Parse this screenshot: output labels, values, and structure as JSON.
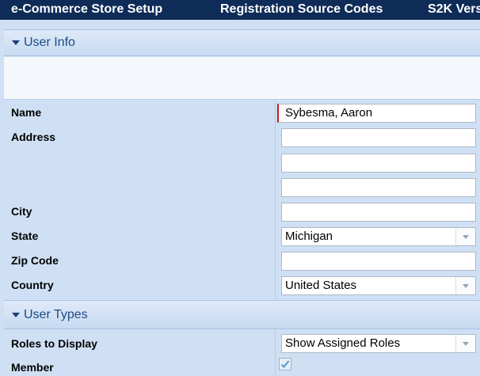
{
  "nav": {
    "items": [
      "e-Commerce Store Setup",
      "Registration Source Codes",
      "S2K Vers"
    ]
  },
  "user_info": {
    "section_title": "User Info",
    "fields": {
      "name": {
        "label": "Name",
        "value": "Sybesma, Aaron"
      },
      "address": {
        "label": "Address",
        "values": [
          "",
          "",
          ""
        ]
      },
      "city": {
        "label": "City",
        "value": ""
      },
      "state": {
        "label": "State",
        "value": "Michigan"
      },
      "zip": {
        "label": "Zip Code",
        "value": ""
      },
      "country": {
        "label": "Country",
        "value": "United States"
      }
    }
  },
  "user_types": {
    "section_title": "User Types",
    "roles": {
      "label": "Roles to Display",
      "value": "Show Assigned Roles"
    },
    "member": {
      "label": "Member",
      "checked": true
    }
  },
  "colors": {
    "nav_bg": "#0f2c58",
    "section_title": "#1c4a86",
    "form_bg": "#d0e0f4",
    "required_marker": "#d4141a",
    "check": "#5b95c9"
  }
}
